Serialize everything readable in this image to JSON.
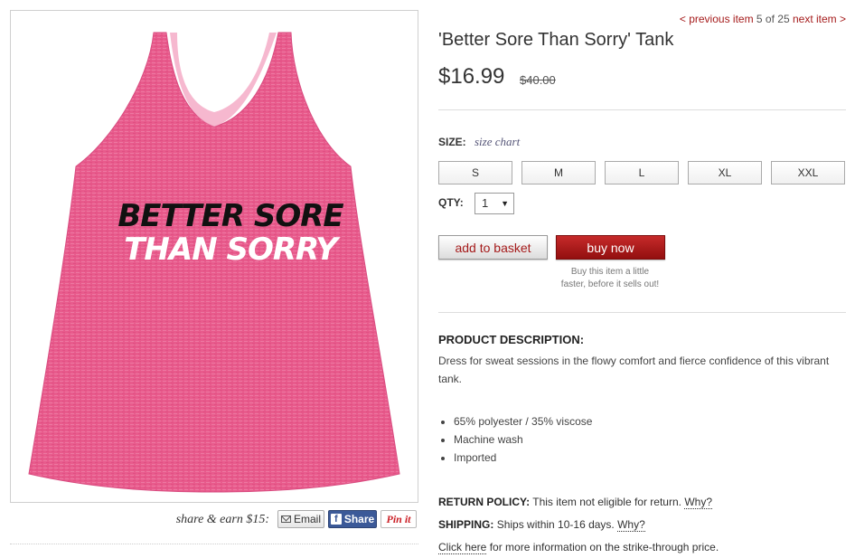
{
  "nav": {
    "previous_label": "< previous item",
    "position": "5 of 25",
    "next_label": "next item >"
  },
  "product": {
    "title": "'Better Sore Than Sorry' Tank",
    "price": "$16.99",
    "original_price": "$40.00",
    "image": {
      "shirt_color": "#e85b8c",
      "print_line_1": "BETTER SORE",
      "print_line_2": "THAN SORRY"
    }
  },
  "size": {
    "label": "SIZE:",
    "chart_link": "size chart",
    "options": [
      "S",
      "M",
      "L",
      "XL",
      "XXL"
    ]
  },
  "qty": {
    "label": "QTY:",
    "selected": "1"
  },
  "actions": {
    "add_to_basket": "add to basket",
    "buy_now": "buy now",
    "buy_note_line1": "Buy this item a little",
    "buy_note_line2": "faster, before it sells out!"
  },
  "share": {
    "label": "share & earn $15:",
    "email": "Email",
    "facebook": "Share",
    "pinterest": "Pin it"
  },
  "description": {
    "heading": "PRODUCT DESCRIPTION:",
    "text": "Dress for sweat sessions in the flowy comfort and fierce confidence of this vibrant tank.",
    "bullets": [
      "65% polyester / 35% viscose",
      "Machine wash",
      "Imported"
    ]
  },
  "policies": {
    "return_label": "RETURN POLICY:",
    "return_text": "This item not eligible for return.",
    "return_link": "Why?",
    "shipping_label": "SHIPPING:",
    "shipping_text": "Ships within 10-16 days.",
    "shipping_link": "Why?",
    "strike_link": "Click here",
    "strike_text": "for more information on the strike-through price."
  },
  "colors": {
    "accent_red": "#a51b1b",
    "buy_button": "#b01d1d",
    "facebook_blue": "#3b5998"
  }
}
